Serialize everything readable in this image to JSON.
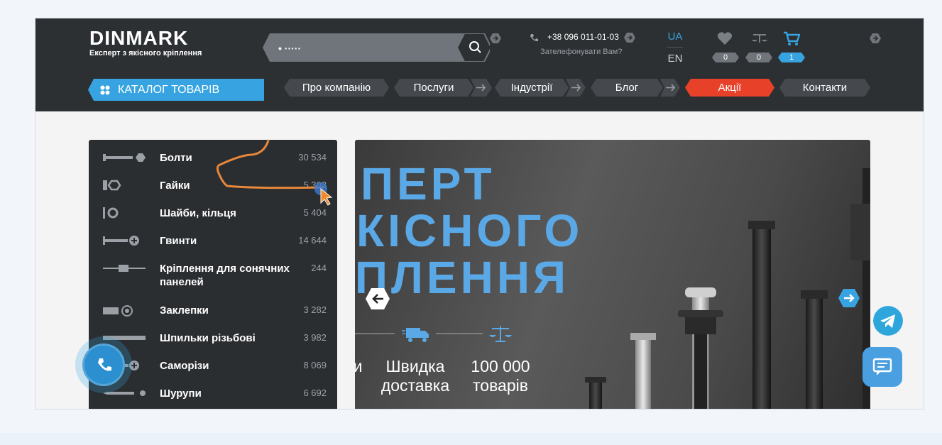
{
  "header": {
    "logo_title": "DINMARK",
    "logo_subtitle": "Експерт з якісного кріплення",
    "search_value": "• ·····",
    "phone": "+38 096 011-01-03",
    "callback": "Зателефонувати Вам?",
    "lang_ua": "UA",
    "lang_en": "EN",
    "favorites_count": "0",
    "compare_count": "0",
    "cart_count": "1"
  },
  "nav": {
    "catalog_label": "КАТАЛОГ ТОВАРІВ",
    "items": [
      {
        "label": "Про компанію"
      },
      {
        "label": "Послуги"
      },
      {
        "label": "Індустрії"
      },
      {
        "label": "Блог"
      },
      {
        "label": "Акції"
      },
      {
        "label": "Контакти"
      }
    ]
  },
  "categories": [
    {
      "name": "Болти",
      "count": "30 534"
    },
    {
      "name": "Гайки",
      "count": "5 303"
    },
    {
      "name": "Шайби, кільця",
      "count": "5 404"
    },
    {
      "name": "Гвинти",
      "count": "14 644"
    },
    {
      "name": "Кріплення для сонячних панелей",
      "count": "244"
    },
    {
      "name": "Заклепки",
      "count": "3 282"
    },
    {
      "name": "Шпильки різьбові",
      "count": "3 982"
    },
    {
      "name": "Саморізи",
      "count": "8 069"
    },
    {
      "name": "Шурупи",
      "count": "6 692"
    }
  ],
  "banner": {
    "line1": "ПЕРТ",
    "line2": "КІСНОГО",
    "line3": "ПЛЕННЯ",
    "feature_partial": "и",
    "feature_delivery": "Швидка доставка",
    "feature_goods": "100 000 товарів"
  },
  "colors": {
    "header_bg": "#2d3033",
    "accent_blue": "#37a4e1",
    "promo_red": "#e8412a",
    "nav_item_bg": "#45494d",
    "banner_text": "#5aa9e6"
  }
}
